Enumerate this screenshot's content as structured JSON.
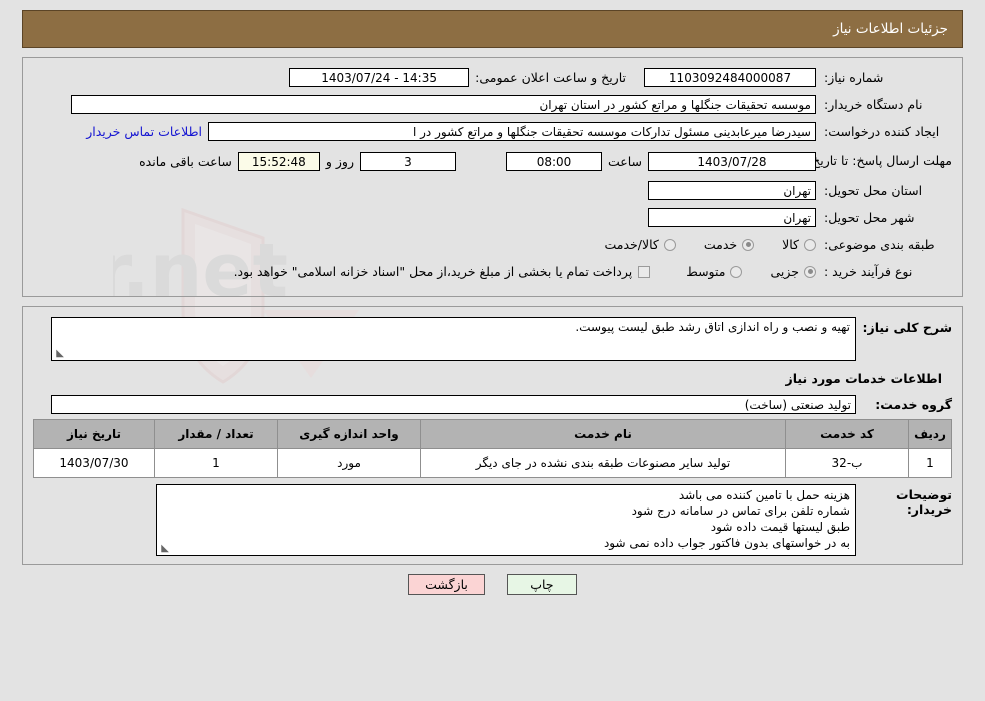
{
  "header": {
    "title": "جزئیات اطلاعات نیاز"
  },
  "form": {
    "need_number_label": "شماره نیاز:",
    "need_number_value": "1103092484000087",
    "announce_datetime_label": "تاریخ و ساعت اعلان عمومی:",
    "announce_datetime_value": "14:35 - 1403/07/24",
    "buyer_org_label": "نام دستگاه خریدار:",
    "buyer_org_value": "موسسه تحقیقات جنگلها و مراتع کشور در استان تهران",
    "creator_label": "ایجاد کننده درخواست:",
    "creator_value": "سیدرضا میرعابدینی مسئول تدارکات موسسه تحقیقات جنگلها و مراتع کشور در ا",
    "contact_link": "اطلاعات تماس خریدار",
    "deadline_label": "مهلت ارسال پاسخ: تا تاریخ:",
    "deadline_date": "1403/07/28",
    "deadline_hour_label": "ساعت",
    "deadline_hour_value": "08:00",
    "remaining_days": "3",
    "remaining_days_label": "روز و",
    "remaining_time": "15:52:48",
    "remaining_suffix": "ساعت باقی مانده",
    "province_label": "استان محل تحویل:",
    "province_value": "تهران",
    "city_label": "شهر محل تحویل:",
    "city_value": "تهران",
    "category_label": "طبقه بندی موضوعی:",
    "category_options": [
      {
        "label": "کالا",
        "selected": false
      },
      {
        "label": "خدمت",
        "selected": true
      },
      {
        "label": "کالا/خدمت",
        "selected": false
      }
    ],
    "process_label": "نوع فرآیند خرید :",
    "process_options": [
      {
        "label": "جزیی",
        "selected": true
      },
      {
        "label": "متوسط",
        "selected": false
      }
    ],
    "treasury_checkbox_label": "پرداخت تمام یا بخشی از مبلغ خرید،از محل \"اسناد خزانه اسلامی\" خواهد بود.",
    "treasury_checked": false
  },
  "description": {
    "label": "شرح کلی نیاز:",
    "value": "تهیه و نصب و راه اندازی اتاق رشد طبق لیست پیوست."
  },
  "services": {
    "section_title": "اطلاعات خدمات مورد نیاز",
    "group_label": "گروه خدمت:",
    "group_value": "تولید صنعتی (ساخت)",
    "columns": [
      "ردیف",
      "کد خدمت",
      "نام خدمت",
      "واحد اندازه گیری",
      "تعداد / مقدار",
      "تاریخ نیاز"
    ],
    "rows": [
      [
        "1",
        "ب-32",
        "تولید سایر مصنوعات طبقه بندی نشده در جای دیگر",
        "مورد",
        "1",
        "1403/07/30"
      ]
    ]
  },
  "notes": {
    "label": "توضیحات خریدار:",
    "lines": [
      "هزینه حمل با تامین کننده می باشد",
      "شماره تلفن برای تماس در سامانه درج شود",
      "طبق لیستها قیمت داده شود",
      "به در خواستهای بدون فاکتور جواب داده نمی شود"
    ]
  },
  "buttons": {
    "print": "چاپ",
    "back": "بازگشت"
  },
  "watermark": {
    "text": "AriaTender.net"
  }
}
